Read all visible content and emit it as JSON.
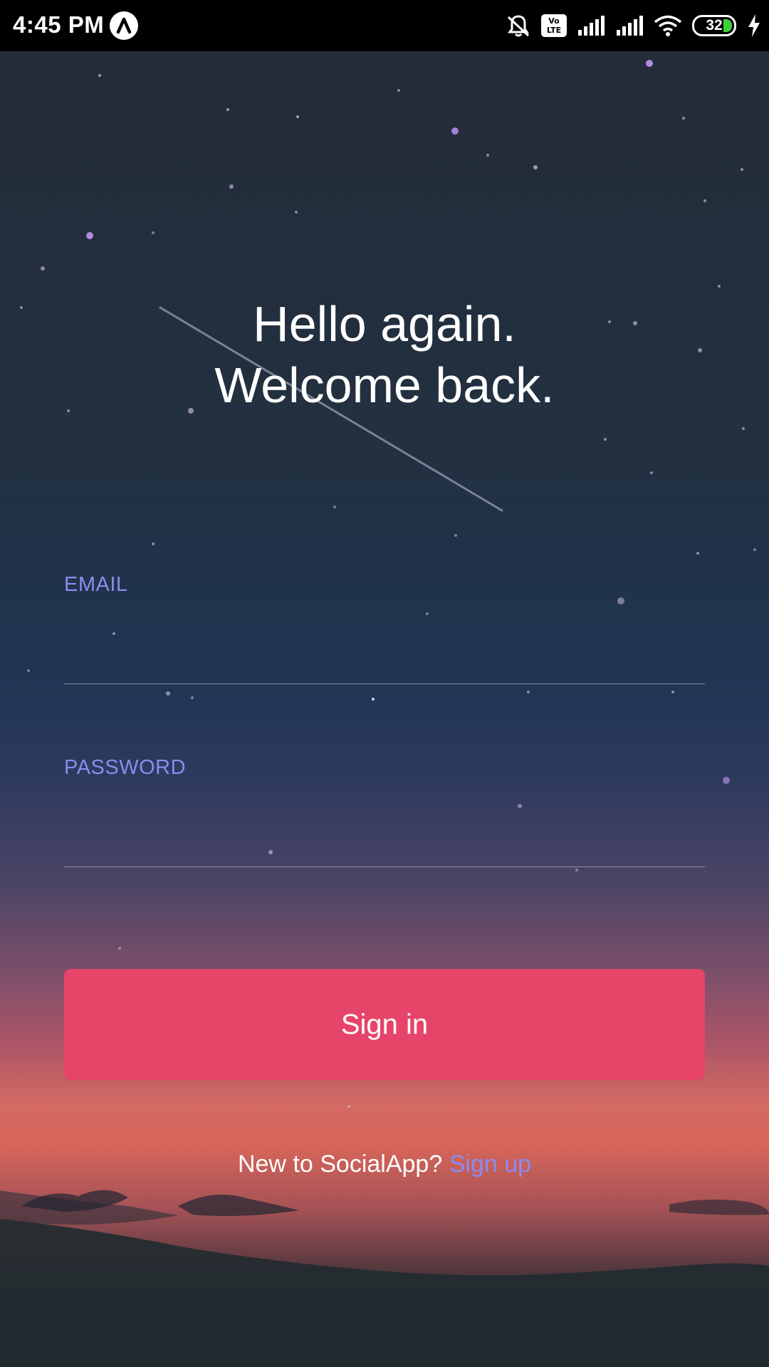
{
  "status_bar": {
    "time": "4:45 PM",
    "app_icon": "rn-app-icon",
    "icons": [
      "bell-off-icon",
      "volte-icon",
      "signal-icon",
      "signal-icon",
      "wifi-icon",
      "battery-icon",
      "charging-icon"
    ],
    "volte_text": "Vo\nLTE",
    "battery_level": "32",
    "battery_color": "#3fcf3a"
  },
  "login": {
    "heading_line1": "Hello again.",
    "heading_line2": "Welcome back.",
    "email_label": "EMAIL",
    "email_value": "",
    "password_label": "PASSWORD",
    "password_value": "",
    "sign_in_label": "Sign in",
    "signup_prompt": "New to SocialApp? ",
    "signup_link": "Sign up"
  },
  "colors": {
    "accent_button": "#e74469",
    "label_color": "#8a8cf0",
    "link_color": "#8a8cf0",
    "text_color": "#ffffff"
  }
}
